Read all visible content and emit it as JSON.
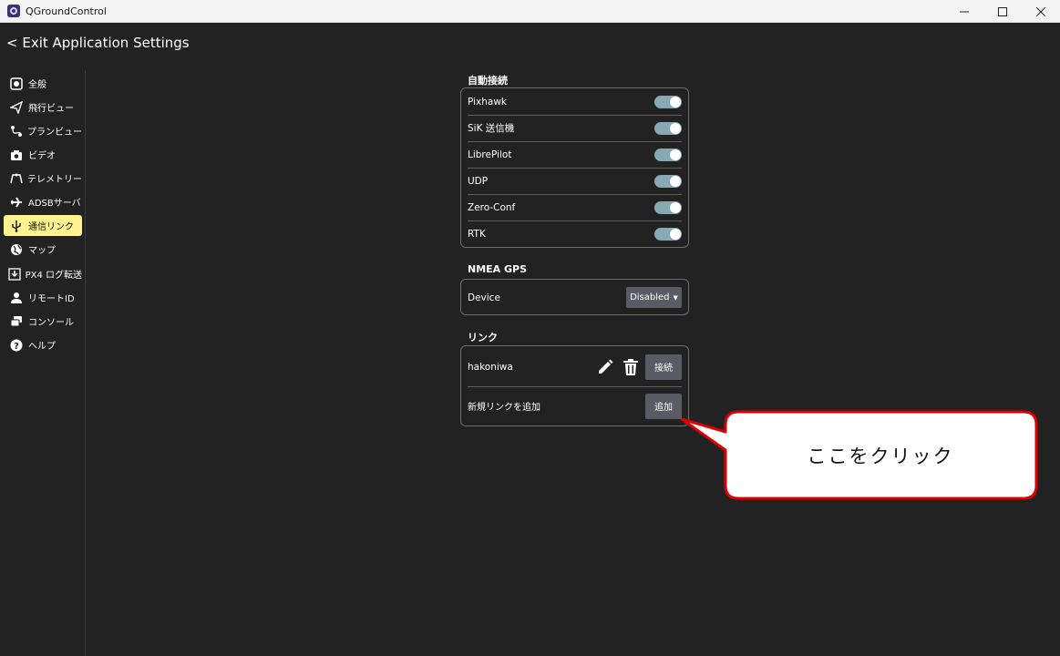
{
  "window": {
    "title": "QGroundControl"
  },
  "header": {
    "exit_label": "< Exit Application Settings"
  },
  "sidebar": {
    "items": [
      {
        "label": "全般",
        "icon": "general-icon"
      },
      {
        "label": "飛行ビュー",
        "icon": "paper-plane-icon"
      },
      {
        "label": "プランビュー",
        "icon": "route-icon"
      },
      {
        "label": "ビデオ",
        "icon": "camera-icon"
      },
      {
        "label": "テレメトリー",
        "icon": "telemetry-icon"
      },
      {
        "label": "ADSBサーバ",
        "icon": "airplane-icon"
      },
      {
        "label": "通信リンク",
        "icon": "usb-icon",
        "active": true
      },
      {
        "label": "マップ",
        "icon": "globe-icon"
      },
      {
        "label": "PX4 ログ転送",
        "icon": "download-icon"
      },
      {
        "label": "リモートID",
        "icon": "person-icon"
      },
      {
        "label": "コンソール",
        "icon": "chat-icon"
      },
      {
        "label": "ヘルプ",
        "icon": "help-icon"
      }
    ]
  },
  "autoconnect": {
    "title": "自動接続",
    "items": [
      {
        "label": "Pixhawk",
        "on": true
      },
      {
        "label": "SiK 送信機",
        "on": true
      },
      {
        "label": "LibrePilot",
        "on": true
      },
      {
        "label": "UDP",
        "on": true
      },
      {
        "label": "Zero-Conf",
        "on": true
      },
      {
        "label": "RTK",
        "on": true
      }
    ]
  },
  "nmea": {
    "title": "NMEA GPS",
    "device_label": "Device",
    "device_value": "Disabled"
  },
  "links": {
    "title": "リンク",
    "link_name": "hakoniwa",
    "connect_label": "接続",
    "add_row_label": "新規リンクを追加",
    "add_label": "追加"
  },
  "callout": {
    "text": "ここをクリック"
  },
  "colors": {
    "toggle_on": "#86a9b4",
    "active_item": "#fff291",
    "callout_border": "#e00000",
    "button": "#5b5b66"
  }
}
